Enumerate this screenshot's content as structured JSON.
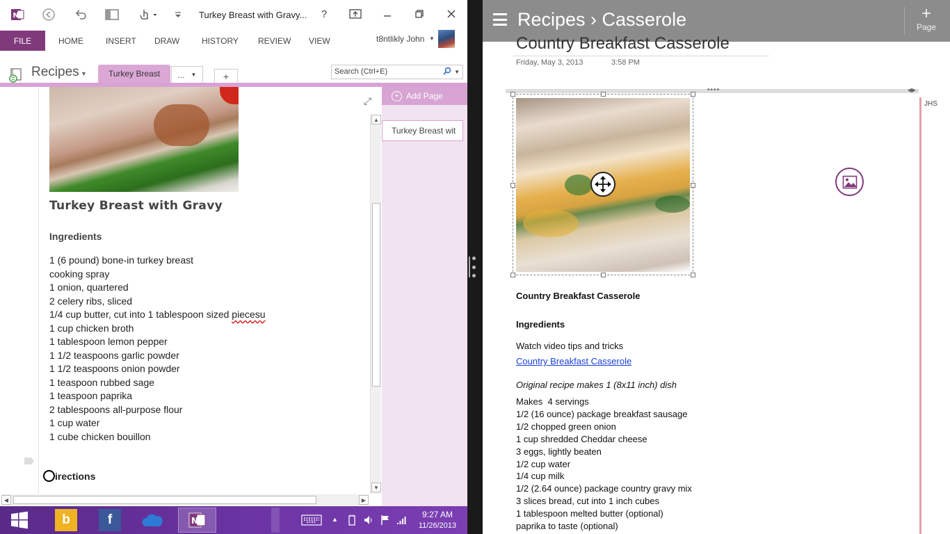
{
  "left_window": {
    "title": "Turkey Breast with Gravy...",
    "help": "?",
    "ribbon_tabs": [
      "FILE",
      "HOME",
      "INSERT",
      "DRAW",
      "HISTORY",
      "REVIEW",
      "VIEW"
    ],
    "user_name": "t8ntlikly John",
    "notebook_name": "Recipes",
    "section_tab": "Turkey Breast",
    "more_tabs_label": "...",
    "new_tab_label": "+",
    "search_placeholder": "Search (Ctrl+E)",
    "add_page_label": "Add Page",
    "page_list": [
      "Turkey Breast wit"
    ],
    "recipe_title": "Turkey Breast with Gravy",
    "ingredients_heading": "Ingredients",
    "ingredients": [
      "1 (6 pound) bone-in turkey breast",
      "cooking spray",
      "1 onion, quartered",
      "2 celery ribs, sliced",
      "1/4 cup butter, cut into 1 tablespoon sized ",
      "1 cup chicken broth",
      "1 tablespoon lemon pepper",
      "1 1/2 teaspoons garlic powder",
      "1 1/2 teaspoons onion powder",
      "1 teaspoon rubbed sage",
      "1 teaspoon paprika",
      "2 tablespoons all-purpose flour",
      "1 cup water",
      "1 cube chicken bouillon"
    ],
    "misspelled_word": "piecesu",
    "directions_heading": "irections"
  },
  "taskbar": {
    "time": "9:27 AM",
    "date": "11/26/2013"
  },
  "right_window": {
    "breadcrumb": "Recipes › Casserole",
    "page_button_label": "Page",
    "page_title": "Country Breakfast Casserole",
    "page_date": "Friday, May 3, 2013",
    "page_time": "3:58 PM",
    "author_initials": "JHS",
    "recipe_title": "Country Breakfast Casserole",
    "ingredients_heading": "Ingredients",
    "video_tip": "Watch video tips and tricks",
    "video_link": "Country Breakfast Casserole",
    "original_note": "Original recipe makes 1 (8x11 inch) dish",
    "items": [
      "Makes  4 servings",
      "1/2 (16 ounce) package breakfast sausage",
      "1/2 chopped green onion",
      "1 cup shredded Cheddar cheese",
      "3 eggs, lightly beaten",
      "1/2 cup water",
      "1/4 cup milk",
      "1/2 (2.64 ounce) package country gravy mix",
      "3 slices bread, cut into 1 inch cubes",
      "1 tablespoon melted butter (optional)",
      "paprika to taste (optional)"
    ]
  },
  "colors": {
    "onenote_purple": "#80397b",
    "section_pink": "#dba8d6",
    "taskbar_purple": "#6a33a2",
    "link_blue": "#1a3fd6"
  }
}
